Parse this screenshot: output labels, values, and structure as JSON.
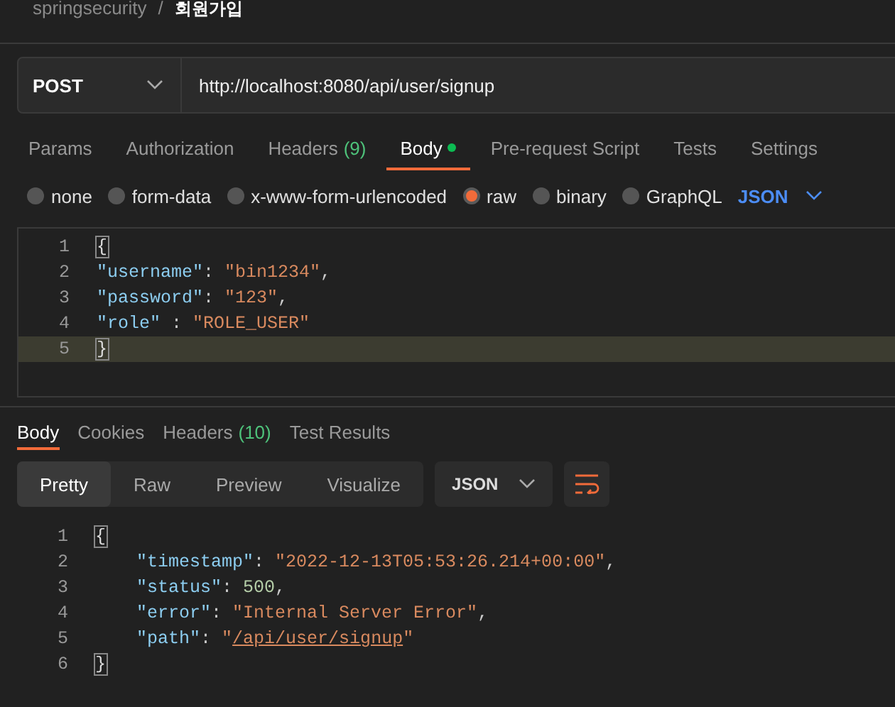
{
  "breadcrumb": {
    "collection": "springsecurity",
    "separator": "/",
    "request": "회원가입"
  },
  "request": {
    "method": "POST",
    "url": "http://localhost:8080/api/user/signup"
  },
  "request_tabs": [
    {
      "label": "Params",
      "selected": false
    },
    {
      "label": "Authorization",
      "selected": false
    },
    {
      "label": "Headers",
      "count": "(9)",
      "selected": false
    },
    {
      "label": "Body",
      "selected": true,
      "dot": true
    },
    {
      "label": "Pre-request Script",
      "selected": false
    },
    {
      "label": "Tests",
      "selected": false
    },
    {
      "label": "Settings",
      "selected": false
    }
  ],
  "body_types": [
    {
      "label": "none",
      "selected": false
    },
    {
      "label": "form-data",
      "selected": false
    },
    {
      "label": "x-www-form-urlencoded",
      "selected": false
    },
    {
      "label": "raw",
      "selected": true
    },
    {
      "label": "binary",
      "selected": false
    },
    {
      "label": "GraphQL",
      "selected": false
    }
  ],
  "body_format": "JSON",
  "request_body": [
    {
      "number": "1",
      "indented": false,
      "highlighted": false,
      "tokens": [
        {
          "kind": "bracket",
          "text": "{"
        }
      ]
    },
    {
      "number": "2",
      "indented": false,
      "highlighted": false,
      "tokens": [
        {
          "kind": "key",
          "text": "\"username\""
        },
        {
          "kind": "punct",
          "text": ": "
        },
        {
          "kind": "string",
          "text": "\"bin1234\""
        },
        {
          "kind": "punct",
          "text": ","
        }
      ]
    },
    {
      "number": "3",
      "indented": false,
      "highlighted": false,
      "tokens": [
        {
          "kind": "key",
          "text": "\"password\""
        },
        {
          "kind": "punct",
          "text": ": "
        },
        {
          "kind": "string",
          "text": "\"123\""
        },
        {
          "kind": "punct",
          "text": ","
        }
      ]
    },
    {
      "number": "4",
      "indented": false,
      "highlighted": false,
      "tokens": [
        {
          "kind": "key",
          "text": "\"role\""
        },
        {
          "kind": "punct",
          "text": " : "
        },
        {
          "kind": "string",
          "text": "\"ROLE_USER\""
        }
      ]
    },
    {
      "number": "5",
      "indented": false,
      "highlighted": true,
      "tokens": [
        {
          "kind": "bracket",
          "text": "}"
        }
      ]
    }
  ],
  "response_tabs": [
    {
      "label": "Body",
      "selected": true
    },
    {
      "label": "Cookies",
      "selected": false
    },
    {
      "label": "Headers",
      "count": "(10)",
      "selected": false
    },
    {
      "label": "Test Results",
      "selected": false
    }
  ],
  "view_modes": [
    {
      "label": "Pretty",
      "selected": true
    },
    {
      "label": "Raw",
      "selected": false
    },
    {
      "label": "Preview",
      "selected": false
    },
    {
      "label": "Visualize",
      "selected": false
    }
  ],
  "response_format": "JSON",
  "response_body": [
    {
      "number": "1",
      "indented": false,
      "highlighted": false,
      "tokens": [
        {
          "kind": "bracket",
          "text": "{"
        }
      ]
    },
    {
      "number": "2",
      "indented": true,
      "highlighted": false,
      "tokens": [
        {
          "kind": "key",
          "text": "\"timestamp\""
        },
        {
          "kind": "punct",
          "text": ": "
        },
        {
          "kind": "string",
          "text": "\"2022-12-13T05:53:26.214+00:00\""
        },
        {
          "kind": "punct",
          "text": ","
        }
      ]
    },
    {
      "number": "3",
      "indented": true,
      "highlighted": false,
      "tokens": [
        {
          "kind": "key",
          "text": "\"status\""
        },
        {
          "kind": "punct",
          "text": ": "
        },
        {
          "kind": "number",
          "text": "500"
        },
        {
          "kind": "punct",
          "text": ","
        }
      ]
    },
    {
      "number": "4",
      "indented": true,
      "highlighted": false,
      "tokens": [
        {
          "kind": "key",
          "text": "\"error\""
        },
        {
          "kind": "punct",
          "text": ": "
        },
        {
          "kind": "string",
          "text": "\"Internal Server Error\""
        },
        {
          "kind": "punct",
          "text": ","
        }
      ]
    },
    {
      "number": "5",
      "indented": true,
      "highlighted": false,
      "tokens": [
        {
          "kind": "key",
          "text": "\"path\""
        },
        {
          "kind": "punct",
          "text": ": "
        },
        {
          "kind": "string",
          "text": "\""
        },
        {
          "kind": "link",
          "text": "/api/user/signup"
        },
        {
          "kind": "string",
          "text": "\""
        }
      ]
    },
    {
      "number": "6",
      "indented": false,
      "highlighted": false,
      "tokens": [
        {
          "kind": "bracket",
          "text": "}"
        }
      ]
    }
  ]
}
